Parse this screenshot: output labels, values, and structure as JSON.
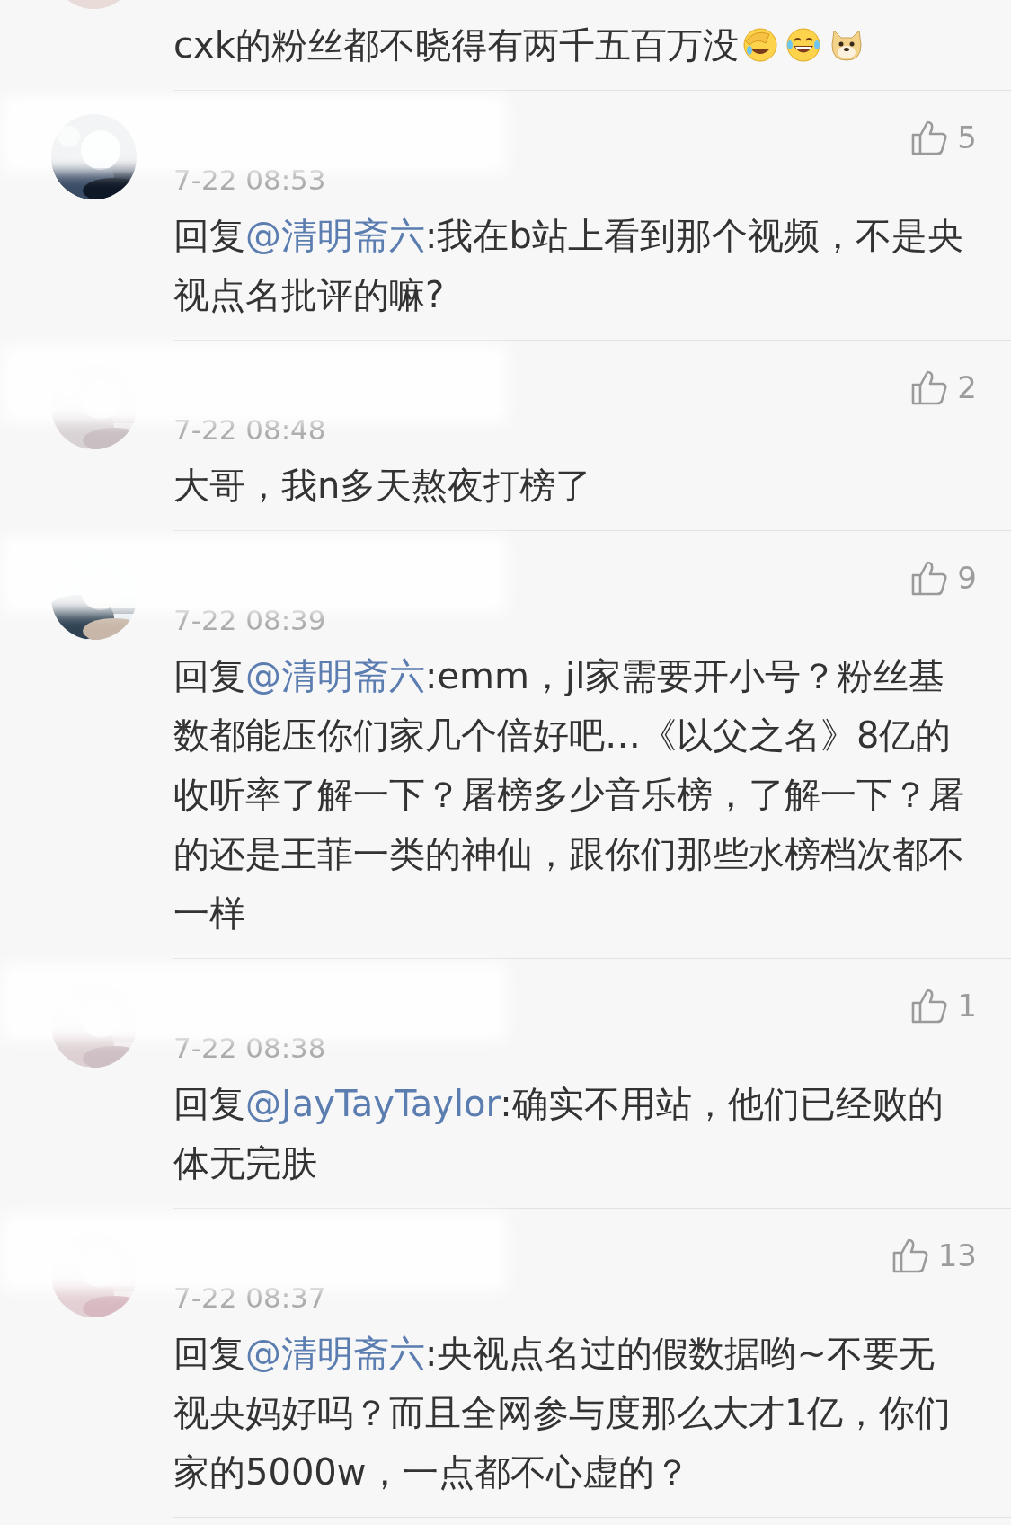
{
  "comments": [
    {
      "text": {
        "body": "cxk的粉丝都不晓得有两千五百万没"
      },
      "emojis": [
        {
          "kind": "facepalm"
        },
        {
          "kind": "laugh"
        },
        {
          "kind": "doge"
        }
      ]
    },
    {
      "time": "7-22 08:53",
      "likes": "5",
      "text": {
        "prefix": "回复",
        "mention": "@清明斋六",
        "body": ":我在b站上看到那个视频，不是央视点名批评的嘛?"
      }
    },
    {
      "time": "7-22 08:48",
      "likes": "2",
      "text": {
        "body": "大哥，我n多天熬夜打榜了"
      }
    },
    {
      "time": "7-22 08:39",
      "likes": "9",
      "text": {
        "prefix": "回复",
        "mention": "@清明斋六",
        "body": ":emm，jl家需要开小号？粉丝基数都能压你们家几个倍好吧…《以父之名》8亿的收听率了解一下？屠榜多少音乐榜，了解一下？屠的还是王菲一类的神仙，跟你们那些水榜档次都不一样"
      }
    },
    {
      "time": "7-22 08:38",
      "likes": "1",
      "text": {
        "prefix": "回复",
        "mention": "@JayTayTaylor",
        "body": ":确实不用站，他们已经败的体无完肤"
      }
    },
    {
      "time": "7-22 08:37",
      "likes": "13",
      "text": {
        "prefix": "回复",
        "mention": "@清明斋六",
        "body": ":央视点名过的假数据哟~不要无视央妈好吗？而且全网参与度那么大才1亿，你们家的5000w，一点都不心虚的？"
      }
    }
  ]
}
